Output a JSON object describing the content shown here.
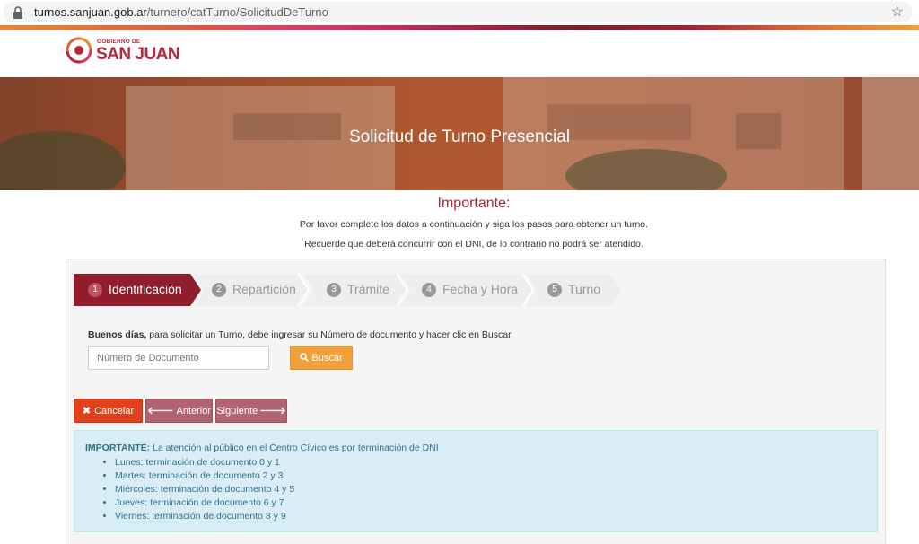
{
  "browser": {
    "url_host": "turnos.sanjuan.gob.ar",
    "url_path": "/turnero/catTurno/SolicitudDeTurno"
  },
  "logo": {
    "small": "GOBIERNO DE",
    "big": "SAN JUAN"
  },
  "hero": {
    "title": "Solicitud de Turno Presencial"
  },
  "important": {
    "title": "Importante:",
    "line1": "Por favor complete los datos a continuación y siga los pasos para obtener un turno.",
    "line2": "Recuerde que deberá concurrir con el DNI, de lo contrario no podrá ser atendido."
  },
  "steps": [
    {
      "num": "1",
      "label": "Identificación",
      "active": true
    },
    {
      "num": "2",
      "label": "Repartición",
      "active": false
    },
    {
      "num": "3",
      "label": "Trámite",
      "active": false
    },
    {
      "num": "4",
      "label": "Fecha y Hora",
      "active": false
    },
    {
      "num": "5",
      "label": "Turno",
      "active": false
    }
  ],
  "form": {
    "greeting_bold": "Buenos días,",
    "greeting_rest": " para solicitar un Turno, debe ingresar su Número de documento y hacer clic en Buscar",
    "doc_placeholder": "Número de Documento",
    "search_label": "Buscar"
  },
  "nav": {
    "cancel_label": "Cancelar",
    "prev_label": "Anterior",
    "next_label": "Siguiente"
  },
  "notice": {
    "bold": "IMPORTANTE:",
    "text": " La atención al público en el Centro Cívico es por terminación de DNI",
    "items": [
      "Lunes: terminación de documento 0 y 1",
      "Martes: terminación de documento 2 y 3",
      "Miércoles: terminación de documento 4 y 5",
      "Jueves: terminación de documento 6 y 7",
      "Viernes: terminación de documento 8 y 9"
    ]
  },
  "colors": {
    "brand": "#b5273a",
    "step_active": "#8f1d2c",
    "step_inactive": "#eeeeee"
  }
}
